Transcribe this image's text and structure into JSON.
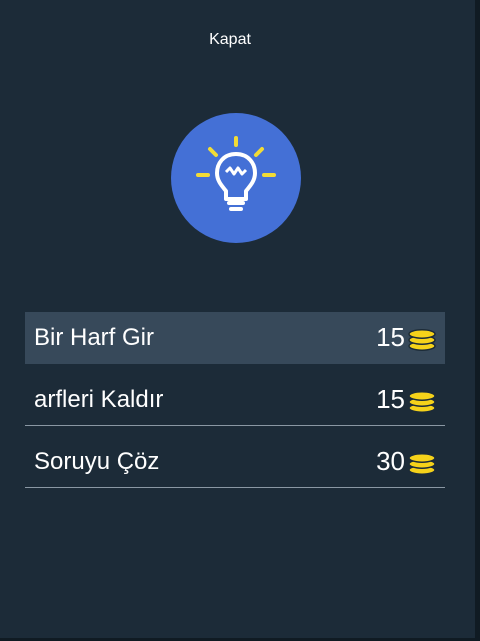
{
  "dialog": {
    "close_label": "Kapat"
  },
  "icons": {
    "hint": "lightbulb-icon",
    "coin": "coin-stack-icon"
  },
  "colors": {
    "background": "#1c2b38",
    "circle": "#4470d6",
    "bulb_rays": "#f2dc36",
    "coin": "#f5d21a",
    "selected_row": "#37495a"
  },
  "options": [
    {
      "label": "Bir Harf Gir",
      "price": "15",
      "selected": true
    },
    {
      "label": "arfleri Kaldır",
      "price": "15",
      "selected": false
    },
    {
      "label": "Soruyu Çöz",
      "price": "30",
      "selected": false
    }
  ]
}
